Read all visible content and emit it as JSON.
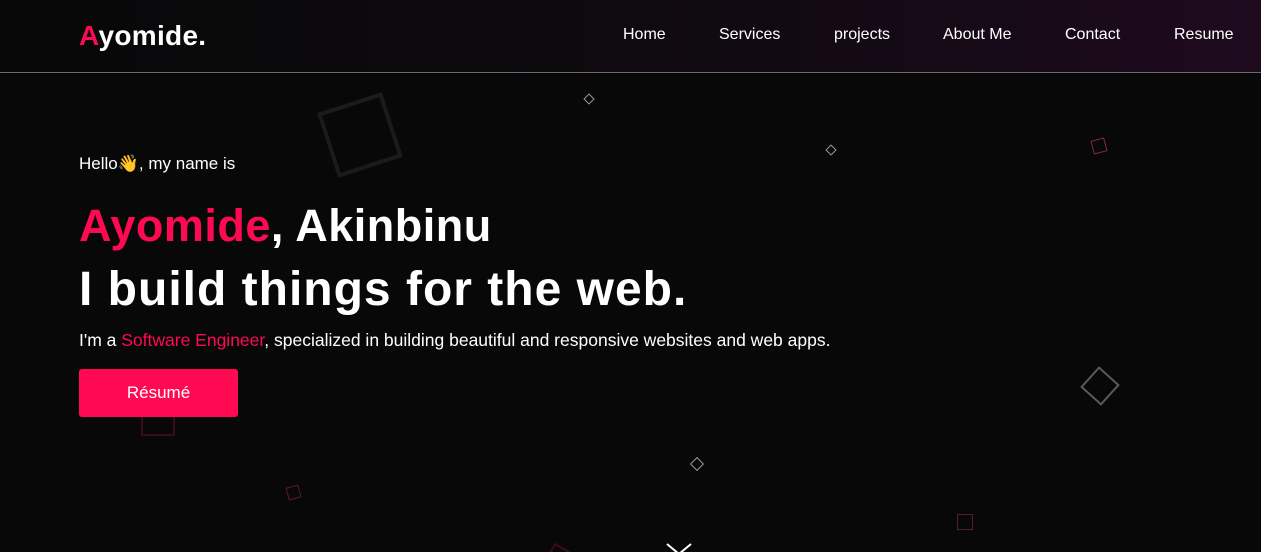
{
  "header": {
    "logo_accent": "A",
    "logo_rest": "yomide."
  },
  "nav": {
    "items": [
      {
        "label": "Home"
      },
      {
        "label": "Services"
      },
      {
        "label": "projects"
      },
      {
        "label": "About Me"
      },
      {
        "label": "Contact"
      },
      {
        "label": "Resume"
      }
    ]
  },
  "hero": {
    "greeting": "Hello👋, my name is",
    "first_name": "Ayomide",
    "last_name": ", Akinbinu",
    "tagline": "I build things for the web.",
    "desc_prefix": "I'm a ",
    "desc_role": "Software Engineer",
    "desc_suffix": ", specialized in building beautiful and responsive websites and web apps.",
    "cta_label": "Résumé"
  },
  "colors": {
    "accent": "#ff0a52",
    "background": "#080808",
    "text": "#ffffff"
  },
  "icons": {
    "scroll_down": "chevron-down-icon"
  }
}
